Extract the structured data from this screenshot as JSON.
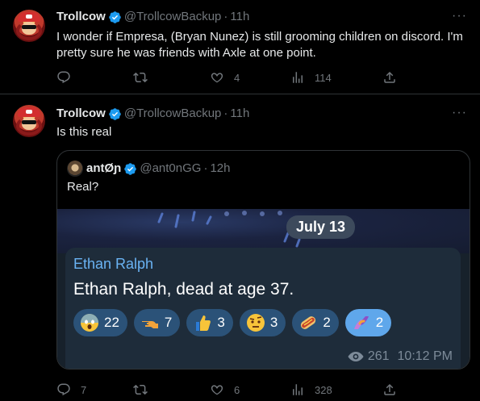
{
  "tweets": [
    {
      "name": "Trollcow",
      "handle": "@TrollcowBackup",
      "time": "11h",
      "text": "I wonder if Empresa, (Bryan Nunez) is still grooming children on discord. I'm pretty sure he was friends with Axle at one point.",
      "replies": "",
      "retweets": "",
      "likes": "4",
      "views": "114"
    },
    {
      "name": "Trollcow",
      "handle": "@TrollcowBackup",
      "time": "11h",
      "text": "Is this real",
      "replies": "7",
      "retweets": "",
      "likes": "6",
      "views": "328",
      "quote": {
        "name": "antØɲ",
        "handle": "@ant0nGG",
        "time": "12h",
        "text": "Real?",
        "media": {
          "date_pill": "July 13",
          "sender": "Ethan Ralph",
          "message": "Ethan Ralph, dead at age 37.",
          "reactions": [
            {
              "emoji": "scream-emoji",
              "count": "22",
              "color": "#f7c43a"
            },
            {
              "emoji": "point-left-emoji",
              "count": "7",
              "color": "#f2a33a"
            },
            {
              "emoji": "thumbs-up-emoji",
              "count": "3",
              "color": "#f7c43a"
            },
            {
              "emoji": "raised-eyebrow-emoji",
              "count": "3",
              "color": "#f7c43a"
            },
            {
              "emoji": "hotdog-emoji",
              "count": "2",
              "color": "#e0663d"
            },
            {
              "emoji": "heart-hands-emoji",
              "count": "2",
              "color": "#b55ad6"
            }
          ],
          "views": "261",
          "time": "10:12 PM"
        }
      }
    }
  ],
  "more_label": "···"
}
